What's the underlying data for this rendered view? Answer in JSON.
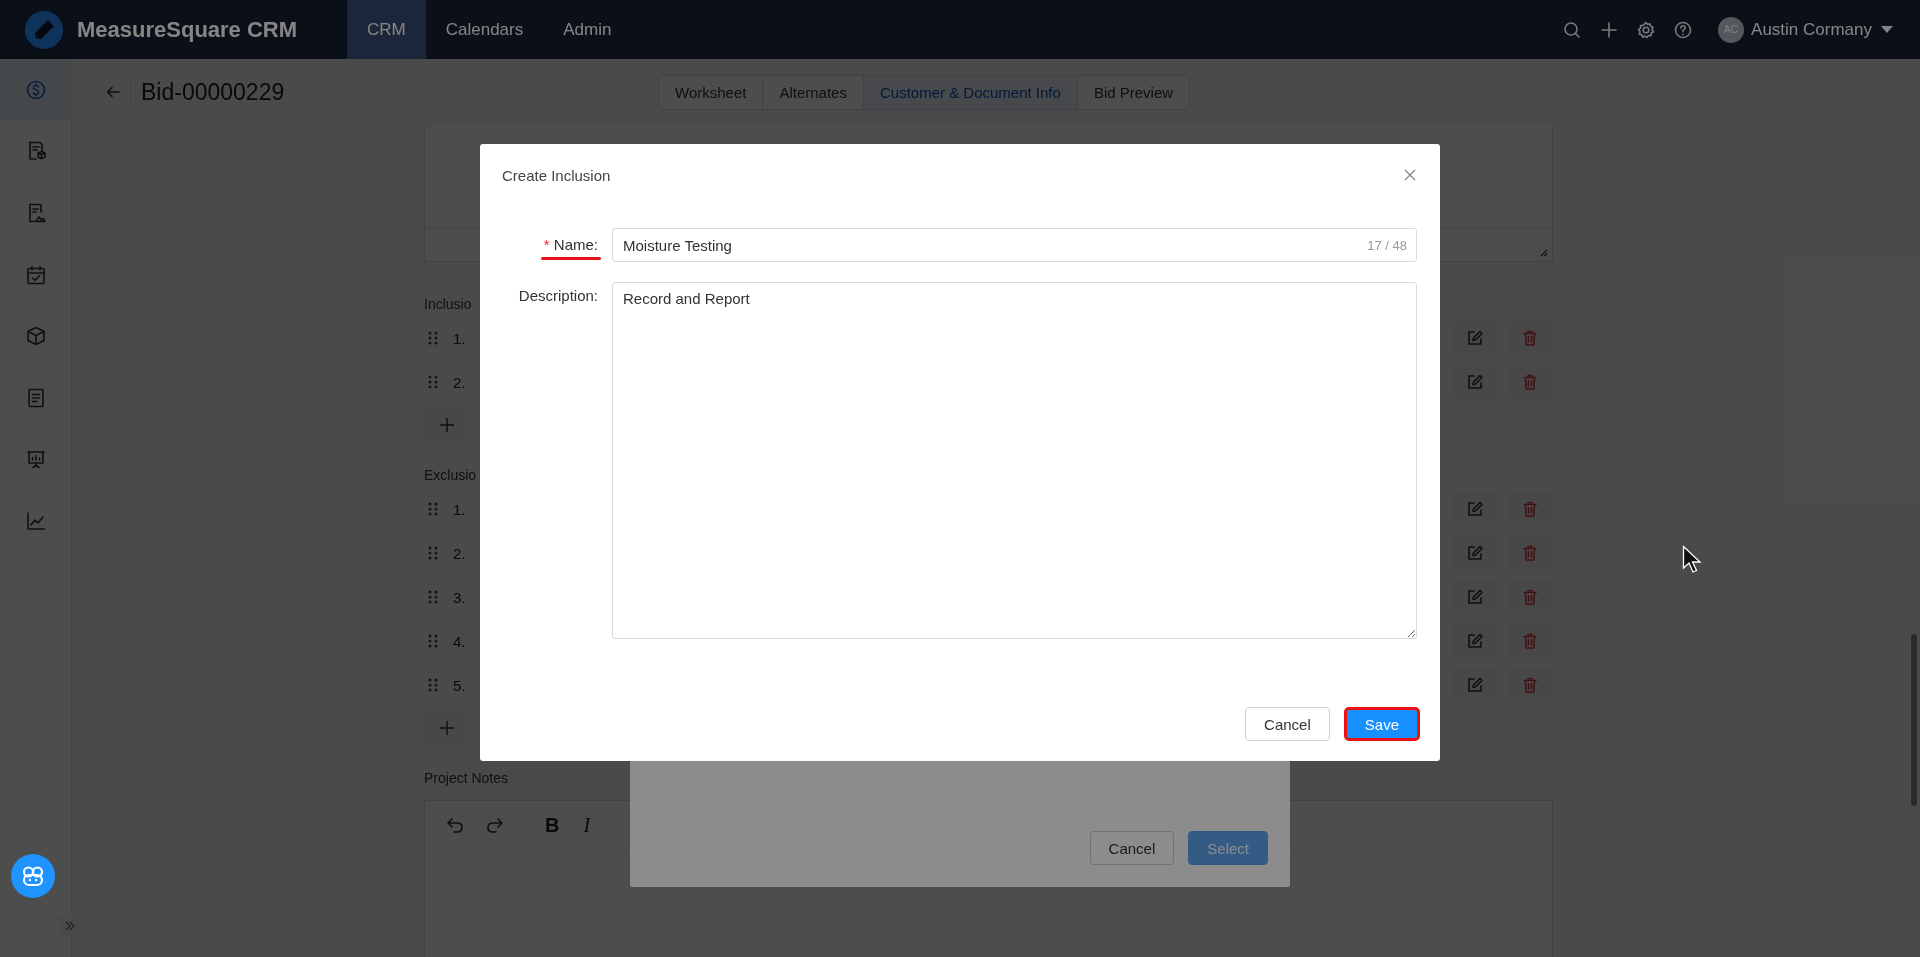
{
  "app": {
    "title": "MeasureSquare CRM"
  },
  "nav": [
    {
      "label": "CRM",
      "selected": true
    },
    {
      "label": "Calendars",
      "selected": false
    },
    {
      "label": "Admin",
      "selected": false
    }
  ],
  "user": {
    "initials": "AC",
    "name": "Austin Cormany"
  },
  "sidebar": {
    "items": [
      {
        "selected": true
      },
      {
        "selected": false
      },
      {
        "selected": false
      },
      {
        "selected": false
      },
      {
        "selected": false
      },
      {
        "selected": false
      },
      {
        "selected": false
      },
      {
        "selected": false
      }
    ]
  },
  "page": {
    "title": "Bid-00000229",
    "tabs": [
      {
        "label": "Worksheet",
        "selected": false
      },
      {
        "label": "Alternates",
        "selected": false
      },
      {
        "label": "Customer & Document Info",
        "selected": true
      },
      {
        "label": "Bid Preview",
        "selected": false
      }
    ]
  },
  "sections": [
    {
      "heading": "Inclusio",
      "rows": [
        "1.",
        "2."
      ]
    },
    {
      "heading": "Exclusio",
      "rows": [
        "1.",
        "2.",
        "3.",
        "4.",
        "5."
      ]
    }
  ],
  "project_notes": {
    "label": "Project Notes",
    "toolbar": [
      {
        "kind": "undo"
      },
      {
        "kind": "redo"
      },
      {
        "kind": "bold",
        "label": "B"
      },
      {
        "kind": "italic",
        "label": "I"
      }
    ]
  },
  "background_dialog": {
    "buttons": [
      {
        "label": "Cancel",
        "kind": "default",
        "disabled": false
      },
      {
        "label": "Select",
        "kind": "primary",
        "disabled": true
      }
    ]
  },
  "dialog": {
    "title": "Create Inclusion",
    "fields": [
      {
        "kind": "input",
        "required_mark": "*",
        "label": "Name:",
        "highlighted": true,
        "value": "Moisture Testing",
        "counter": "17 / 48"
      },
      {
        "kind": "textarea",
        "label": "Description:",
        "highlighted": false,
        "value": "Record and Report"
      }
    ],
    "buttons": [
      {
        "label": "Cancel",
        "kind": "default",
        "highlighted": false
      },
      {
        "label": "Save",
        "kind": "primary",
        "highlighted": true
      }
    ]
  }
}
